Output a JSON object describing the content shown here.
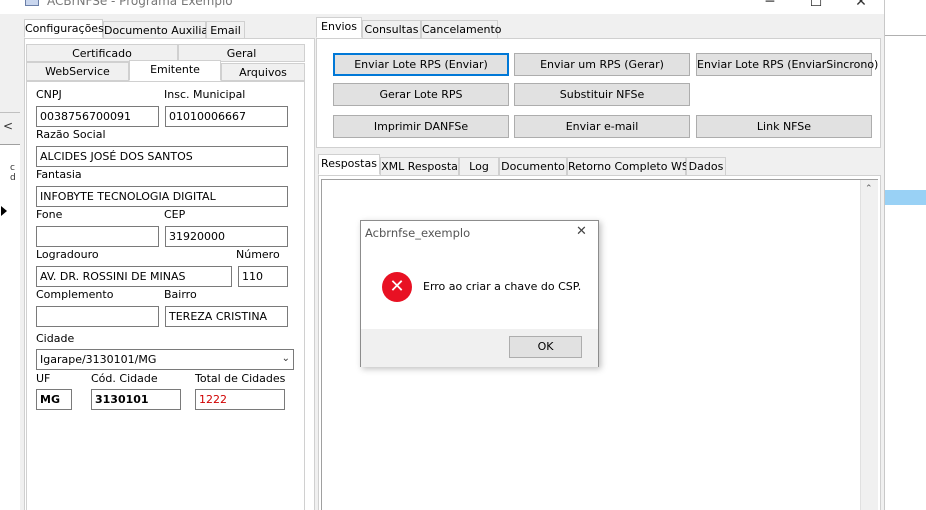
{
  "window": {
    "title": "ACBrNFSe - Programa Exemplo",
    "controls": {
      "minimize": "─",
      "maximize": "☐",
      "close": "✕"
    }
  },
  "left_tabs": [
    "Configurações",
    "Documento Auxiliar",
    "Email"
  ],
  "config_tabs": {
    "row1": [
      "Certificado",
      "Geral"
    ],
    "row2": [
      "WebService",
      "Emitente",
      "Arquivos"
    ]
  },
  "emitente": {
    "cnpj_label": "CNPJ",
    "cnpj": "0038756700091",
    "im_label": "Insc. Municipal",
    "im": "01010006667",
    "razao_label": "Razão Social",
    "razao": "ALCIDES JOSÉ DOS SANTOS",
    "fantasia_label": "Fantasia",
    "fantasia": "INFOBYTE TECNOLOGIA DIGITAL",
    "fone_label": "Fone",
    "fone": "",
    "cep_label": "CEP",
    "cep": "31920000",
    "logradouro_label": "Logradouro",
    "logradouro": "AV. DR. ROSSINI DE MINAS",
    "numero_label": "Número",
    "numero": "110",
    "complemento_label": "Complemento",
    "complemento": "",
    "bairro_label": "Bairro",
    "bairro": "TEREZA CRISTINA",
    "cidade_label": "Cidade",
    "cidade": "Igarape/3130101/MG",
    "uf_label": "UF",
    "uf": "MG",
    "cod_cidade_label": "Cód. Cidade",
    "cod_cidade": "3130101",
    "total_cidades_label": "Total de Cidades",
    "total_cidades": "1222"
  },
  "right_tabs": [
    "Envios",
    "Consultas",
    "Cancelamento"
  ],
  "buttons": {
    "enviar_lote": "Enviar Lote RPS (Enviar)",
    "enviar_um": "Enviar um RPS (Gerar)",
    "enviar_sincrono": "Enviar Lote RPS (EnviarSincrono)",
    "gerar_lote": "Gerar Lote RPS",
    "substituir": "Substituir NFSe",
    "imprimir": "Imprimir DANFSe",
    "enviar_email": "Enviar e-mail",
    "link": "Link NFSe"
  },
  "response_tabs": [
    "Respostas",
    "XML Resposta",
    "Log",
    "Documento",
    "Retorno Completo WS",
    "Dados"
  ],
  "dialog": {
    "title": "Acbrnfse_exemplo",
    "message": "Erro ao criar a chave do CSP.",
    "ok": "OK",
    "close": "✕",
    "error_glyph": "✕"
  },
  "background": {
    "left_fragment": "c\nd",
    "scroll_arrow": "<"
  },
  "colors": {
    "accent": "#0078d7",
    "error": "#e81123",
    "total_text": "#d00000",
    "selection": "#99d1f5"
  }
}
